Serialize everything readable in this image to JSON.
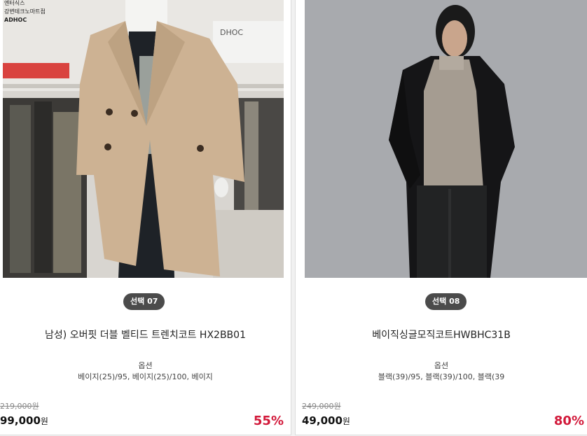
{
  "products": [
    {
      "badge": "선택 07",
      "name": "남성) 오버핏 더블 벨티드 트렌치코트 HX2BB01",
      "option_label": "옵션",
      "option_values": "베이지(25)/95, 베이지(25)/100, 베이지",
      "original_price": "219,000원",
      "price": "99,000",
      "currency": "원",
      "discount": "55%",
      "image_overlay": [
        "엔터식스",
        "강변테크노마트점",
        "ADHOC"
      ]
    },
    {
      "badge": "선택 08",
      "name": "베이직싱글모직코트HWBHC31B",
      "option_label": "옵션",
      "option_values": "블랙(39)/95, 블랙(39)/100, 블랙(39",
      "original_price": "249,000원",
      "price": "49,000",
      "currency": "원",
      "discount": "80%"
    }
  ],
  "colors": {
    "discount": "#d2193a",
    "badge_bg": "#4b4b4b"
  }
}
